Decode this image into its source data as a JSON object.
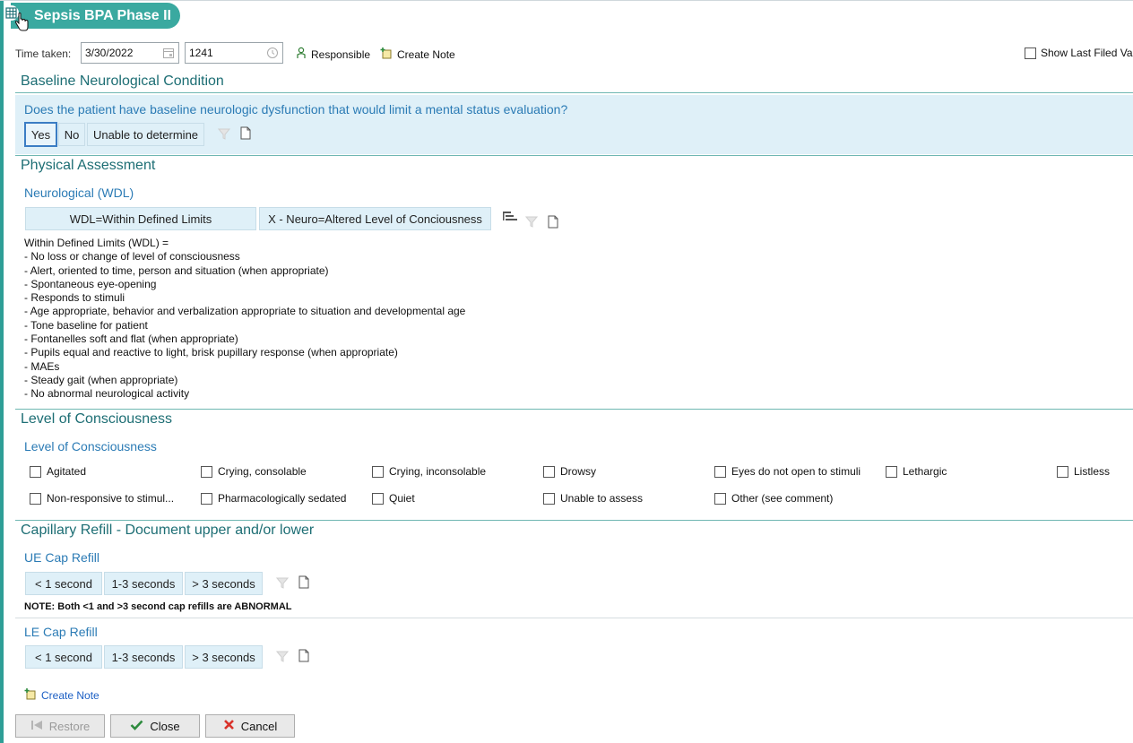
{
  "window": {
    "title": "Sepsis BPA Phase II"
  },
  "header": {
    "time_taken_label": "Time taken:",
    "date_value": "3/30/2022",
    "time_value": "1241",
    "responsible_label": "Responsible",
    "create_note_label": "Create Note",
    "show_last_filed_label": "Show Last Filed Va"
  },
  "baseline": {
    "section_title": "Baseline Neurological Condition",
    "question": "Does the patient have baseline neurologic dysfunction that would limit a mental status evaluation?",
    "options": [
      "Yes",
      "No",
      "Unable to determine"
    ],
    "selected": "Yes"
  },
  "physical": {
    "section_title": "Physical Assessment",
    "neuro_title": "Neurological (WDL)",
    "options": [
      "WDL=Within Defined Limits",
      "X - Neuro=Altered Level of Conciousness"
    ],
    "wdl_lines": [
      "Within Defined Limits (WDL) =",
      "- No loss or change of level of consciousness",
      "- Alert, oriented to time, person and situation (when appropriate)",
      "- Spontaneous eye-opening",
      "- Responds to stimuli",
      "- Age appropriate, behavior and verbalization appropriate to situation and developmental age",
      "- Tone baseline for patient",
      "- Fontanelles soft and flat (when appropriate)",
      "- Pupils equal and reactive to light, brisk pupillary response (when appropriate)",
      "- MAEs",
      "- Steady gait (when appropriate)",
      "- No abnormal neurological activity"
    ]
  },
  "loc": {
    "section_title": "Level of Consciousness",
    "sub_title": "Level of Consciousness",
    "row1": [
      "Agitated",
      "Crying, consolable",
      "Crying, inconsolable",
      "Drowsy",
      "Eyes do not open to stimuli",
      "Lethargic",
      "Listless"
    ],
    "row2": [
      "Non-responsive to stimul...",
      "Pharmacologically sedated",
      "Quiet",
      "Unable to assess",
      "Other (see comment)"
    ]
  },
  "cap": {
    "section_title": "Capillary Refill - Document upper and/or lower",
    "ue_title": "UE Cap Refill",
    "le_title": "LE Cap Refill",
    "options": [
      "< 1 second",
      "1-3 seconds",
      "> 3 seconds"
    ],
    "note": "NOTE: Both <1 and >3 second cap refills are ABNORMAL"
  },
  "footer": {
    "create_note_label": "Create Note",
    "restore_label": "Restore",
    "close_label": "Close",
    "cancel_label": "Cancel"
  },
  "colors": {
    "accent": "#3aa9a0",
    "section_text": "#1d6e74",
    "subtitle_text": "#2b7bb5",
    "option_bg": "#dff0f8",
    "link": "#1c5fc4",
    "cancel_red": "#d9322a",
    "close_green": "#2e8b3e"
  }
}
